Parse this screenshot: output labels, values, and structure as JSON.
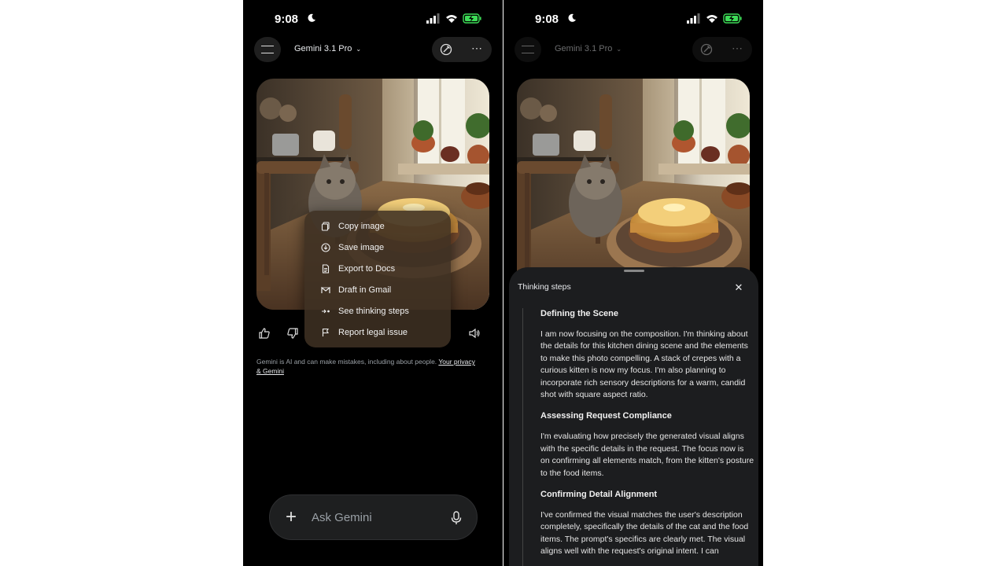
{
  "left": {
    "status": {
      "time": "9:08"
    },
    "header": {
      "model_name": "Gemini 3.1 Pro"
    },
    "context_menu": {
      "items": [
        {
          "label": "Copy image",
          "icon": "copy-icon"
        },
        {
          "label": "Save image",
          "icon": "download-icon"
        },
        {
          "label": "Export to Docs",
          "icon": "docs-icon"
        },
        {
          "label": "Draft in Gmail",
          "icon": "gmail-icon"
        },
        {
          "label": "See thinking steps",
          "icon": "thinking-steps-icon"
        },
        {
          "label": "Report legal issue",
          "icon": "flag-icon"
        }
      ]
    },
    "disclaimer": {
      "text": "Gemini is AI and can make mistakes, including about people. ",
      "link": "Your privacy & Gemini"
    },
    "ask_bar": {
      "placeholder": "Ask Gemini"
    }
  },
  "right": {
    "status": {
      "time": "9:08"
    },
    "header": {
      "model_name": "Gemini 3.1 Pro"
    },
    "sheet": {
      "title": "Thinking steps",
      "steps": [
        {
          "title": "Defining the Scene",
          "body": "I am now focusing on the composition. I'm thinking about the details for this kitchen dining scene and the elements to make this photo compelling. A stack of crepes with a curious kitten is now my focus. I'm also planning to incorporate rich sensory descriptions for a warm, candid shot with square aspect ratio."
        },
        {
          "title": "Assessing Request Compliance",
          "body": "I'm evaluating how precisely the generated visual aligns with the specific details in the request. The focus now is on confirming all elements match, from the kitten's posture to the food items."
        },
        {
          "title": "Confirming Detail Alignment",
          "body": "I've confirmed the visual matches the user's description completely, specifically the details of the cat and the food items. The prompt's specifics are clearly met. The visual aligns well with the request's original intent. I can"
        }
      ]
    }
  },
  "colors": {
    "background": "#000000",
    "sheet": "#1c1d1f",
    "menu": "#3e3022"
  }
}
